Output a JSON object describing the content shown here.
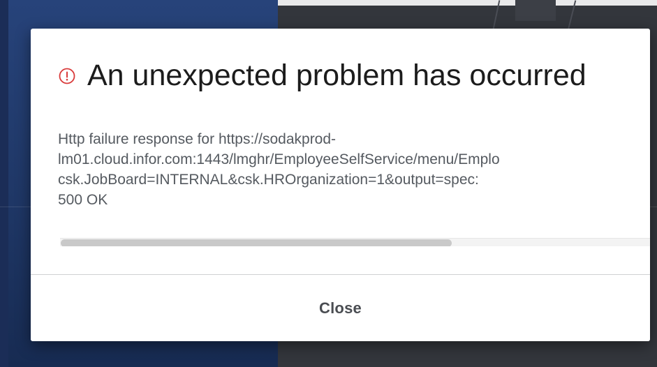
{
  "dialog": {
    "title": "An unexpected problem has occurred",
    "icon": "alert-circle-icon",
    "icon_color": "#d93a3a",
    "message_lines": [
      "Http failure response for https://sodakprod-",
      "lm01.cloud.infor.com:1443/lmghr/EmployeeSelfService/menu/Emplo",
      "csk.JobBoard=INTERNAL&csk.HROrganization=1&output=spec:",
      "500 OK"
    ],
    "close_label": "Close"
  },
  "colors": {
    "backdrop_left": "#27437a",
    "backdrop_right": "#33363c",
    "dialog_background": "#ffffff",
    "title_text": "#1c1c1c",
    "body_text": "#555a60"
  }
}
